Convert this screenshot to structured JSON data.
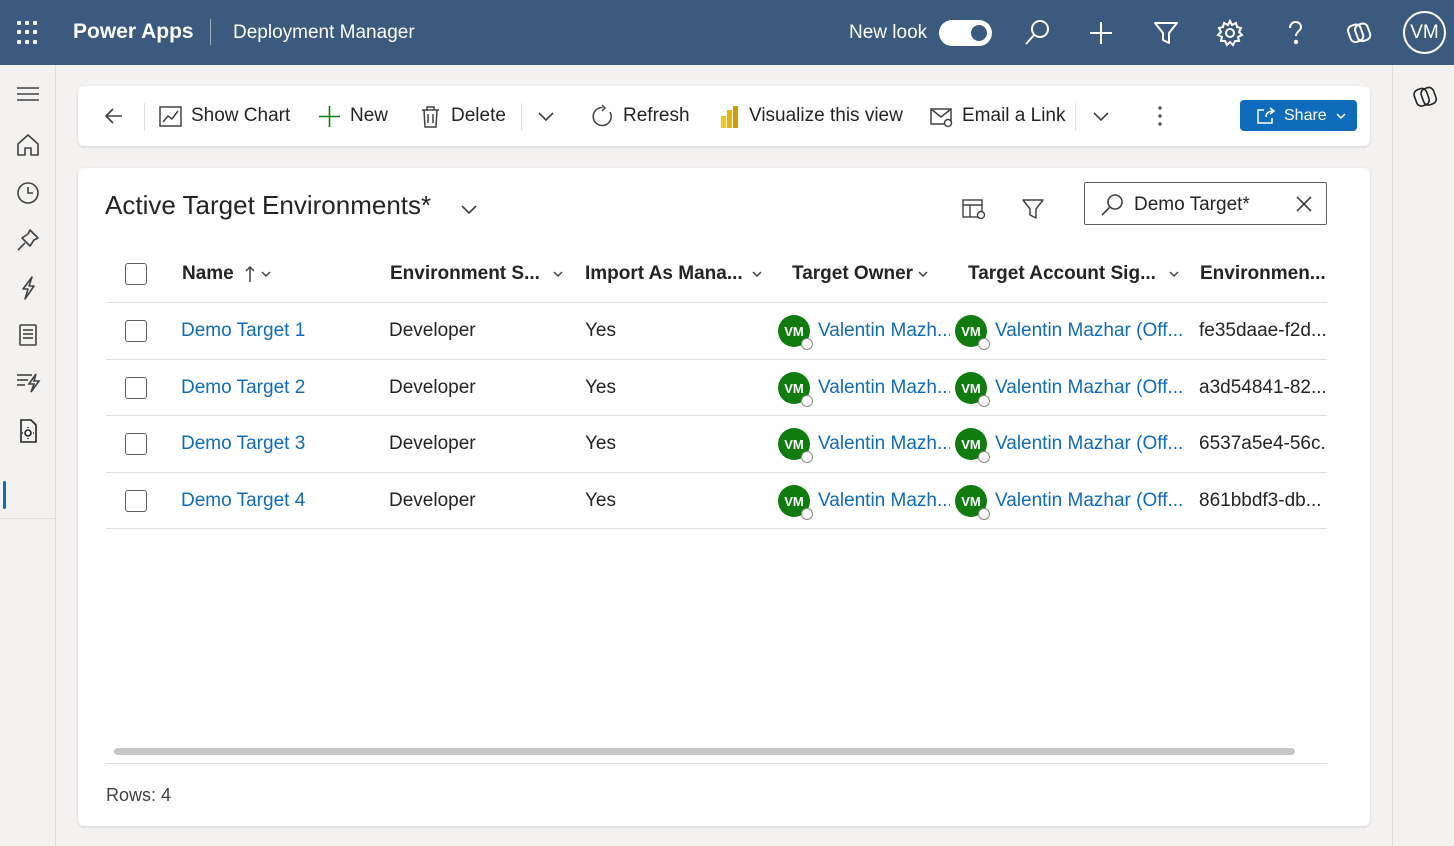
{
  "topbar": {
    "brand": "Power Apps",
    "app_name": "Deployment Manager",
    "new_look_label": "New look",
    "avatar_initials": "VM",
    "icons": [
      "waffle-icon",
      "search-icon",
      "plus-icon",
      "filter-icon",
      "settings-icon",
      "help-icon",
      "copilot-icon"
    ]
  },
  "leftrail": {
    "icons": [
      "hamburger-icon",
      "home-icon",
      "recent-icon",
      "pinned-icon",
      "deployment-icon",
      "list-icon",
      "pipeline-icon",
      "environment-settings-icon"
    ]
  },
  "commandbar": {
    "show_chart": "Show Chart",
    "new": "New",
    "delete": "Delete",
    "refresh": "Refresh",
    "visualize": "Visualize this view",
    "email_link": "Email a Link",
    "share": "Share"
  },
  "view": {
    "title": "Active Target Environments*",
    "search_value": "Demo Target*"
  },
  "table": {
    "columns": [
      "Name",
      "Environment S...",
      "Import As Mana...",
      "Target Owner",
      "Target Account Sig...",
      "Environmen..."
    ],
    "rows": [
      {
        "name": "Demo Target 1",
        "env_type": "Developer",
        "import_managed": "Yes",
        "owner_initials": "VM",
        "owner": "Valentin Mazh...",
        "account_initials": "VM",
        "account": "Valentin Mazhar (Off...",
        "env_id": "fe35daae-f2d..."
      },
      {
        "name": "Demo Target 2",
        "env_type": "Developer",
        "import_managed": "Yes",
        "owner_initials": "VM",
        "owner": "Valentin Mazh...",
        "account_initials": "VM",
        "account": "Valentin Mazhar (Off...",
        "env_id": "a3d54841-82..."
      },
      {
        "name": "Demo Target 3",
        "env_type": "Developer",
        "import_managed": "Yes",
        "owner_initials": "VM",
        "owner": "Valentin Mazh...",
        "account_initials": "VM",
        "account": "Valentin Mazhar (Off...",
        "env_id": "6537a5e4-56c..."
      },
      {
        "name": "Demo Target 4",
        "env_type": "Developer",
        "import_managed": "Yes",
        "owner_initials": "VM",
        "owner": "Valentin Mazh...",
        "account_initials": "VM",
        "account": "Valentin Mazhar (Off...",
        "env_id": "861bbdf3-db..."
      }
    ]
  },
  "footer": {
    "row_count": "Rows: 4"
  },
  "colors": {
    "header_bg": "#3b5a7e",
    "accent": "#0f6cbd",
    "avatar_green": "#107c10"
  }
}
